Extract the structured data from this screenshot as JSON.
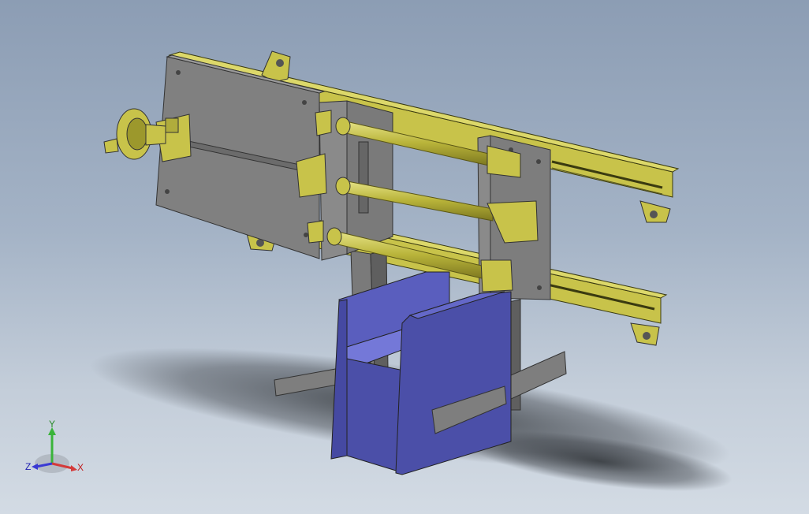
{
  "viewport": {
    "background_top": "#8c9db4",
    "background_bottom": "#d3dbe4"
  },
  "colors": {
    "plate_grey": "#7f7f7f",
    "rail_yellow": "#c8c34a",
    "rail_yellow_dark": "#8f8a1f",
    "box_blue": "#4b4fa8",
    "box_blue_light": "#6468c8",
    "shadow": "#3a3e44"
  },
  "triad": {
    "x_label": "X",
    "y_label": "Y",
    "z_label": "Z",
    "x_color": "#d43a3a",
    "y_color": "#3ab43a",
    "z_color": "#3a3ad4"
  }
}
